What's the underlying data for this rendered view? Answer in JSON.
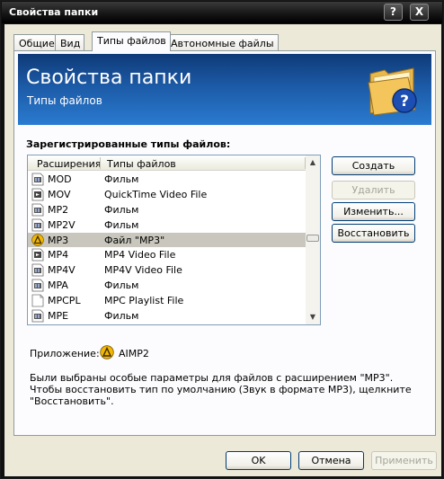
{
  "window": {
    "title": "Свойства папки",
    "help_button": "?",
    "close_button": "X"
  },
  "tabs": [
    {
      "label": "Общие"
    },
    {
      "label": "Вид"
    },
    {
      "label": "Типы файлов"
    },
    {
      "label": "Автономные файлы"
    }
  ],
  "banner": {
    "title": "Свойства папки",
    "subtitle": "Типы файлов"
  },
  "registered_label": "Зарегистрированные типы файлов:",
  "list": {
    "columns": [
      "Расширения",
      "Типы файлов"
    ],
    "rows": [
      {
        "ext": "MOD",
        "type": "Фильм",
        "icon": "film-file-icon"
      },
      {
        "ext": "MOV",
        "type": "QuickTime Video File",
        "icon": "media-file-icon"
      },
      {
        "ext": "MP2",
        "type": "Фильм",
        "icon": "film-file-icon"
      },
      {
        "ext": "MP2V",
        "type": "Фильм",
        "icon": "film-file-icon"
      },
      {
        "ext": "MP3",
        "type": "Файл \"MP3\"",
        "icon": "aimp-icon",
        "selected": true
      },
      {
        "ext": "MP4",
        "type": "MP4 Video File",
        "icon": "media-file-icon"
      },
      {
        "ext": "MP4V",
        "type": "MP4V Video File",
        "icon": "film-file-icon"
      },
      {
        "ext": "MPA",
        "type": "Фильм",
        "icon": "film-file-icon"
      },
      {
        "ext": "MPCPL",
        "type": "MPC Playlist File",
        "icon": "blank-file-icon"
      },
      {
        "ext": "MPE",
        "type": "Фильм",
        "icon": "film-file-icon"
      }
    ]
  },
  "side_buttons": {
    "create": "Создать",
    "delete": "Удалить",
    "change": "Изменить...",
    "restore": "Восстановить"
  },
  "application": {
    "label": "Приложение:",
    "name": "AIMP2"
  },
  "note": "Были выбраны особые параметры для файлов с расширением \"MP3\". Чтобы восстановить тип по умолчанию (Звук в формате MP3), щелкните \"Восстановить\".",
  "footer": {
    "ok": "OK",
    "cancel": "Отмена",
    "apply": "Применить"
  },
  "colors": {
    "banner": "#1c5aa6",
    "dialog_bg": "#ece9d8",
    "selection": "#c9c7bd"
  }
}
